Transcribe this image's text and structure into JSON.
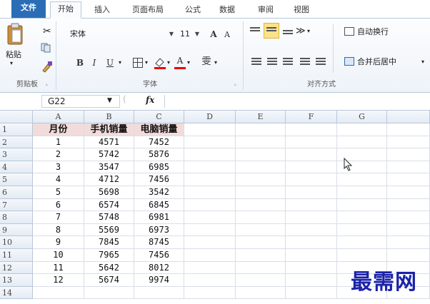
{
  "tabs": [
    "文件",
    "开始",
    "插入",
    "页面布局",
    "公式",
    "数据",
    "审阅",
    "视图"
  ],
  "clipboard": {
    "paste_label": "粘贴",
    "group_label": "剪贴板"
  },
  "font": {
    "name": "宋体",
    "size": "11",
    "grow": "A",
    "shrink": "A",
    "bold": "B",
    "italic": "I",
    "underline": "U",
    "font_color": "A",
    "phonetic": "雯",
    "group_label": "字体"
  },
  "alignment": {
    "wrap_text": "自动换行",
    "merge_center": "合并后居中",
    "group_label": "对齐方式"
  },
  "formula_bar": {
    "name_box": "G22",
    "fx": "fx",
    "formula": ""
  },
  "columns": [
    "A",
    "B",
    "C",
    "D",
    "E",
    "F",
    "G"
  ],
  "row_numbers": [
    "1",
    "2",
    "3",
    "4",
    "5",
    "6",
    "7",
    "8",
    "9",
    "10",
    "11",
    "12",
    "13",
    "14"
  ],
  "table": {
    "headers": [
      "月份",
      "手机销量",
      "电脑销量"
    ],
    "rows": [
      [
        "1",
        "4571",
        "7452"
      ],
      [
        "2",
        "5742",
        "5876"
      ],
      [
        "3",
        "3547",
        "6985"
      ],
      [
        "4",
        "4712",
        "7456"
      ],
      [
        "5",
        "5698",
        "3542"
      ],
      [
        "6",
        "6574",
        "6845"
      ],
      [
        "7",
        "5748",
        "6981"
      ],
      [
        "8",
        "5569",
        "6973"
      ],
      [
        "9",
        "7845",
        "8745"
      ],
      [
        "10",
        "7965",
        "7456"
      ],
      [
        "11",
        "5642",
        "8012"
      ],
      [
        "12",
        "5674",
        "9974"
      ]
    ]
  },
  "watermark": "最需网",
  "colors": {
    "file_tab": "#2a6db5",
    "header_fill": "#f2dcdb",
    "watermark": "#1a22a8"
  }
}
